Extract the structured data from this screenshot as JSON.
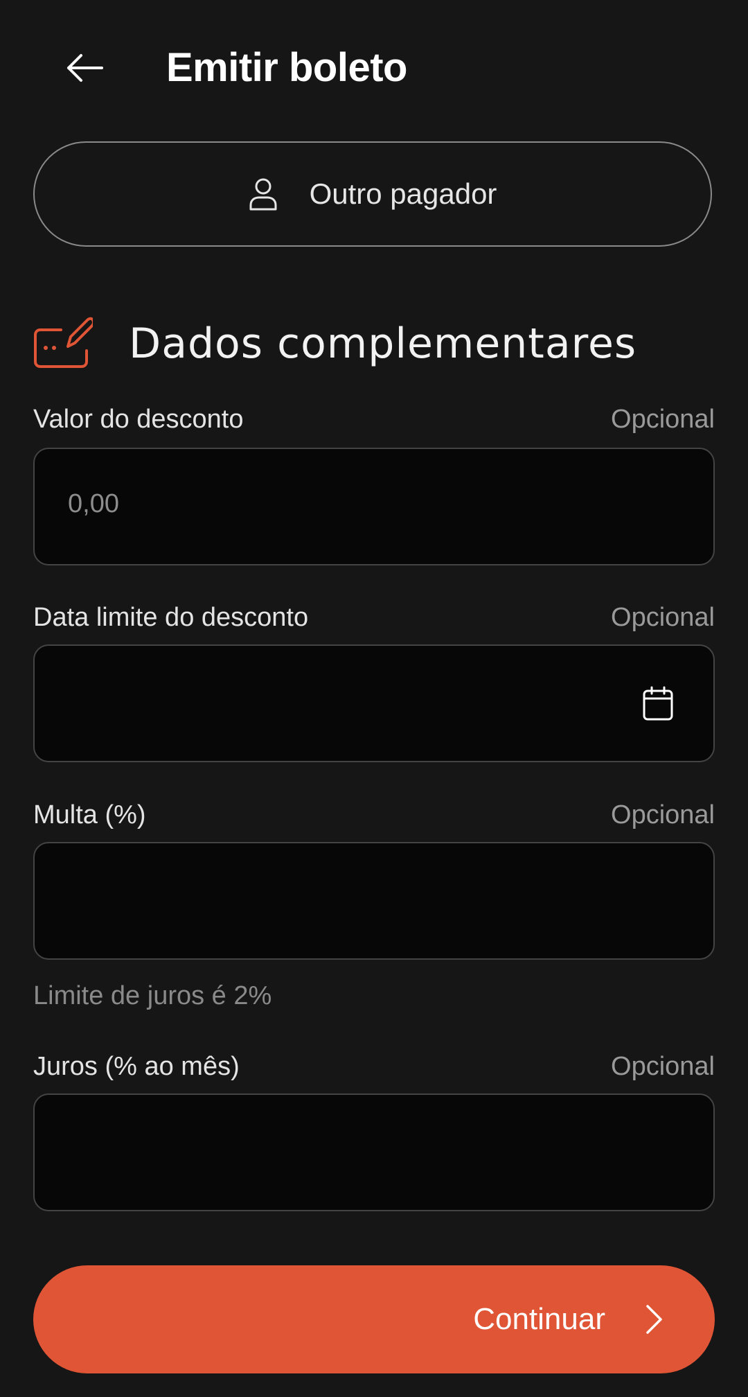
{
  "header": {
    "title": "Emitir boleto",
    "back_icon": "arrow-left-icon"
  },
  "payer_button": {
    "label": "Outro pagador",
    "icon": "user-icon"
  },
  "section": {
    "title": "Dados complementares",
    "icon": "edit-card-icon"
  },
  "fields": [
    {
      "label": "Valor do desconto",
      "optional": "Opcional",
      "placeholder": "0,00"
    },
    {
      "label": "Data limite do desconto",
      "optional": "Opcional",
      "icon": "calendar-icon"
    },
    {
      "label": "Multa (%)",
      "optional": "Opcional",
      "hint": "Limite de juros é 2%"
    },
    {
      "label": "Juros (% ao mês)",
      "optional": "Opcional"
    }
  ],
  "continue_button": {
    "label": "Continuar",
    "icon": "chevron-right-icon"
  },
  "colors": {
    "accent": "#e05535",
    "background": "#161616",
    "field_bg": "#070707"
  }
}
